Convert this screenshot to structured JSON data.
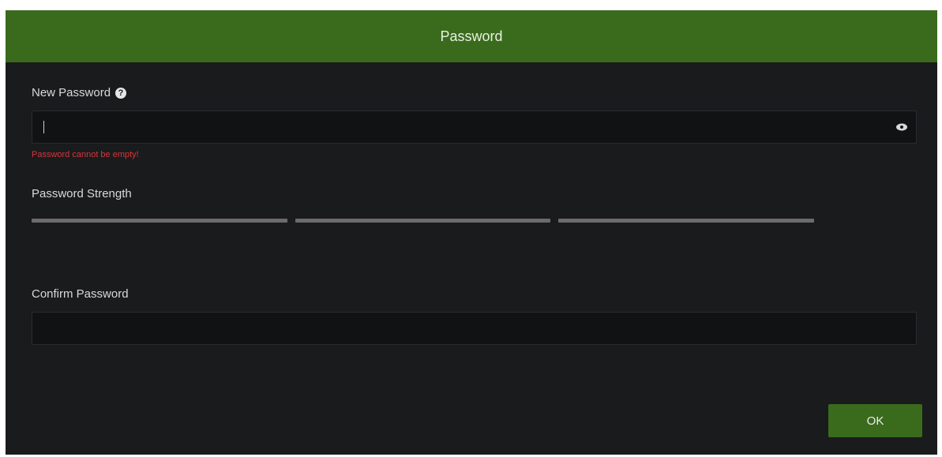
{
  "dialog": {
    "title": "Password",
    "new_password": {
      "label": "New Password",
      "help_icon": "question-circle-icon",
      "value": "",
      "toggle_icon": "eye-icon",
      "error": "Password cannot be empty!"
    },
    "strength": {
      "label": "Password Strength",
      "segments": 3,
      "level": 0
    },
    "confirm_password": {
      "label": "Confirm Password",
      "value": ""
    },
    "ok_label": "OK"
  },
  "colors": {
    "header": "#3a6b1d",
    "background": "#1a1b1d",
    "error": "#d8343a",
    "strength_empty": "#6b6b6b"
  }
}
